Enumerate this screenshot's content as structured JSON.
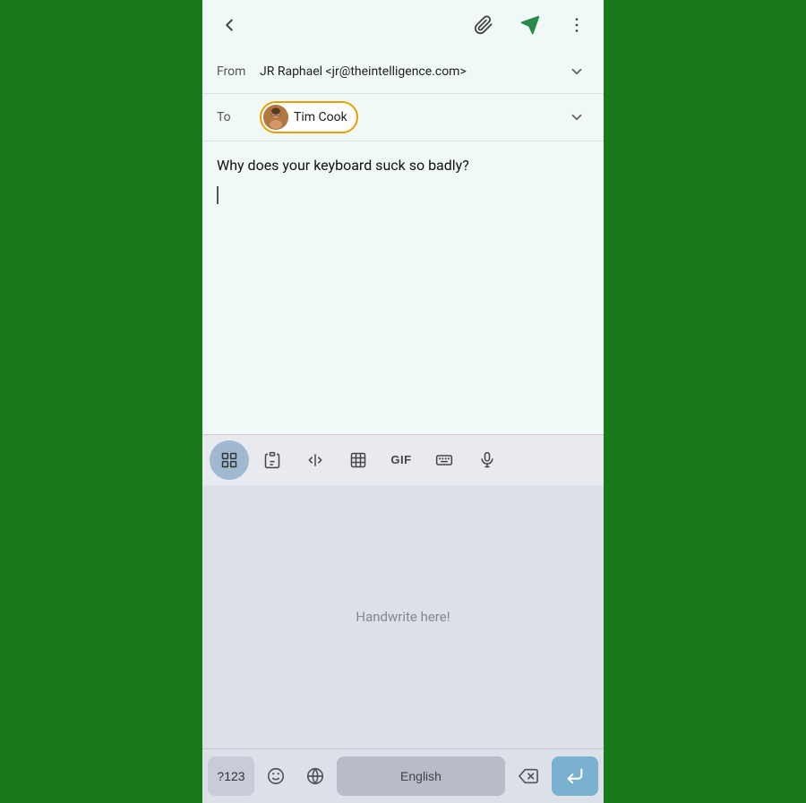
{
  "toolbar": {
    "back_label": "←",
    "attach_label": "attach",
    "send_label": "send",
    "more_label": "⋮"
  },
  "from_row": {
    "label": "From",
    "value": "JR Raphael <jr@theintelligence.com>",
    "chevron": "▾"
  },
  "to_row": {
    "label": "To",
    "recipient_name": "Tim Cook",
    "chevron": "▾"
  },
  "email_body": {
    "subject": "Why does your keyboard suck so badly?"
  },
  "keyboard_toolbar": {
    "items_label": "⊞",
    "clipboard_label": "📋",
    "cursor_label": "⇄",
    "translate_label": "⬚",
    "gif_label": "GIF",
    "keyboard_label": "⌨",
    "mic_label": "🎤"
  },
  "handwrite_area": {
    "placeholder": "Handwrite here!"
  },
  "bottom_keyboard": {
    "num_label": "?123",
    "emoji_label": "☺",
    "globe_label": "🌐",
    "space_label": "English",
    "delete_label": "⌫",
    "enter_label": "↵"
  }
}
